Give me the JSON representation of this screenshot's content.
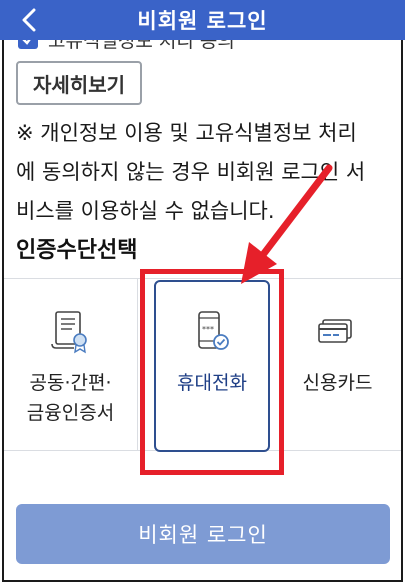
{
  "header": {
    "title": "비회원 로그인",
    "back_icon": "chevron-left-icon"
  },
  "consent": {
    "clipped_label": "고유식별정보 처리 동의",
    "checked": true
  },
  "detail_button": {
    "label": "자세히보기"
  },
  "notice": {
    "line1": "※ 개인정보 이용 및 고유식별정보 처리",
    "line2": "에 동의하지 않는 경우 비회원 로그인 서",
    "line3": "비스를 이용하실 수 없습니다."
  },
  "auth_section": {
    "title": "인증수단선택",
    "methods": [
      {
        "line1": "공동·간편·",
        "line2": "금융인증서",
        "icon": "certificate-icon",
        "selected": false
      },
      {
        "line1": "휴대전화",
        "line2": "",
        "icon": "mobile-phone-icon",
        "selected": true
      },
      {
        "line1": "신용카드",
        "line2": "",
        "icon": "credit-card-icon",
        "selected": false
      }
    ]
  },
  "submit": {
    "label": "비회원 로그인"
  },
  "colors": {
    "brand": "#3a63c8",
    "button_disabled": "#7e9bd4",
    "highlight": "#e6202a",
    "selected_border": "#2e4f8f"
  }
}
